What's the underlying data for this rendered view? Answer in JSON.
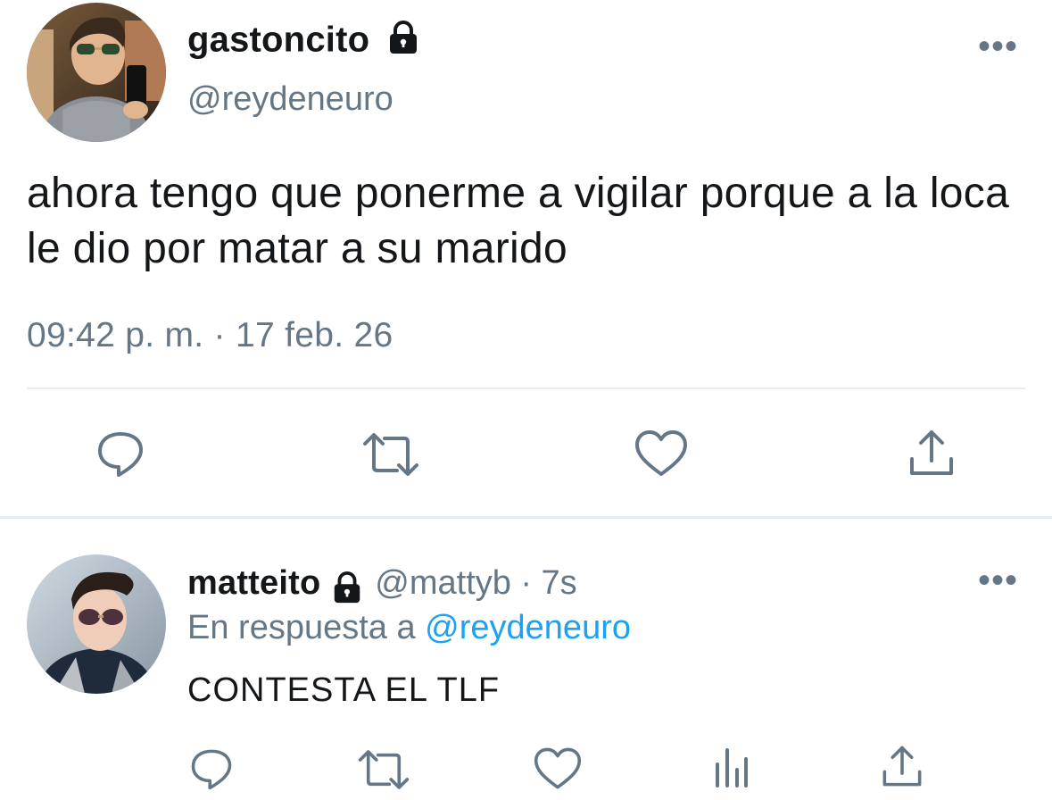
{
  "main_tweet": {
    "display_name": "gastoncito",
    "handle": "@reydeneuro",
    "text": "ahora tengo que ponerme a vigilar porque a la loca le dio por matar a su marido",
    "timestamp": "09:42 p. m. · 17 feb. 26",
    "more_label": "•••",
    "actions": [
      "reply-icon",
      "retweet-icon",
      "like-icon",
      "share-icon"
    ]
  },
  "reply_tweet": {
    "display_name": "matteito",
    "handle": "@mattyb",
    "separator": "·",
    "time": "7s",
    "in_reply_prefix": "En respuesta a",
    "in_reply_handle": "@reydeneuro",
    "text": "CONTESTA EL TLF",
    "more_label": "•••",
    "actions": [
      "reply-icon",
      "retweet-icon",
      "like-icon",
      "analytics-icon",
      "share-icon"
    ]
  },
  "colors": {
    "text": "#14171a",
    "secondary": "#657786",
    "link": "#1da1f2",
    "divider": "#e6ecf0"
  }
}
